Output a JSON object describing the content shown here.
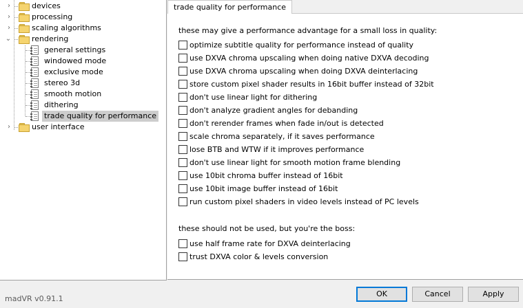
{
  "tree": {
    "items": [
      {
        "label": "devices",
        "kind": "folder",
        "expander": "collapsed"
      },
      {
        "label": "processing",
        "kind": "folder",
        "expander": "collapsed"
      },
      {
        "label": "scaling algorithms",
        "kind": "folder",
        "expander": "collapsed"
      },
      {
        "label": "rendering",
        "kind": "folder",
        "expander": "expanded"
      },
      {
        "label": "general settings",
        "kind": "page"
      },
      {
        "label": "windowed mode",
        "kind": "page"
      },
      {
        "label": "exclusive mode",
        "kind": "page"
      },
      {
        "label": "stereo 3d",
        "kind": "page"
      },
      {
        "label": "smooth motion",
        "kind": "page"
      },
      {
        "label": "dithering",
        "kind": "page"
      },
      {
        "label": "trade quality for performance",
        "kind": "page",
        "selected": true
      },
      {
        "label": "user interface",
        "kind": "folder",
        "expander": "collapsed"
      }
    ]
  },
  "tab": {
    "title": "trade quality for performance"
  },
  "sections": [
    {
      "heading": "these may give a performance advantage for a small loss in quality:",
      "options": [
        {
          "label": "optimize subtitle quality for performance instead of quality",
          "checked": false
        },
        {
          "label": "use DXVA chroma upscaling when doing native DXVA decoding",
          "checked": false
        },
        {
          "label": "use DXVA chroma upscaling when doing DXVA deinterlacing",
          "checked": false
        },
        {
          "label": "store custom pixel shader results in 16bit buffer instead of 32bit",
          "checked": false
        },
        {
          "label": "don't use linear light for dithering",
          "checked": false
        },
        {
          "label": "don't analyze gradient angles for debanding",
          "checked": false
        },
        {
          "label": "don't rerender frames when fade in/out is detected",
          "checked": false
        },
        {
          "label": "scale chroma separately, if it saves performance",
          "checked": false
        },
        {
          "label": "lose BTB and WTW if it improves performance",
          "checked": false
        },
        {
          "label": "don't use linear light for smooth motion frame blending",
          "checked": false
        },
        {
          "label": "use 10bit chroma buffer instead of 16bit",
          "checked": false
        },
        {
          "label": "use 10bit image buffer instead of 16bit",
          "checked": false
        },
        {
          "label": "run custom pixel shaders in video levels instead of PC levels",
          "checked": false
        }
      ]
    },
    {
      "heading": "these should not be used, but you're the boss:",
      "options": [
        {
          "label": "use half frame rate for DXVA deinterlacing",
          "checked": false
        },
        {
          "label": "trust DXVA color & levels conversion",
          "checked": false
        }
      ]
    }
  ],
  "footer": {
    "version": "madVR v0.91.1",
    "ok_label": "OK",
    "cancel_label": "Cancel",
    "apply_label": "Apply"
  },
  "colors": {
    "default_button_border": "#0078d7",
    "selection_bg": "#cdcdcd"
  }
}
